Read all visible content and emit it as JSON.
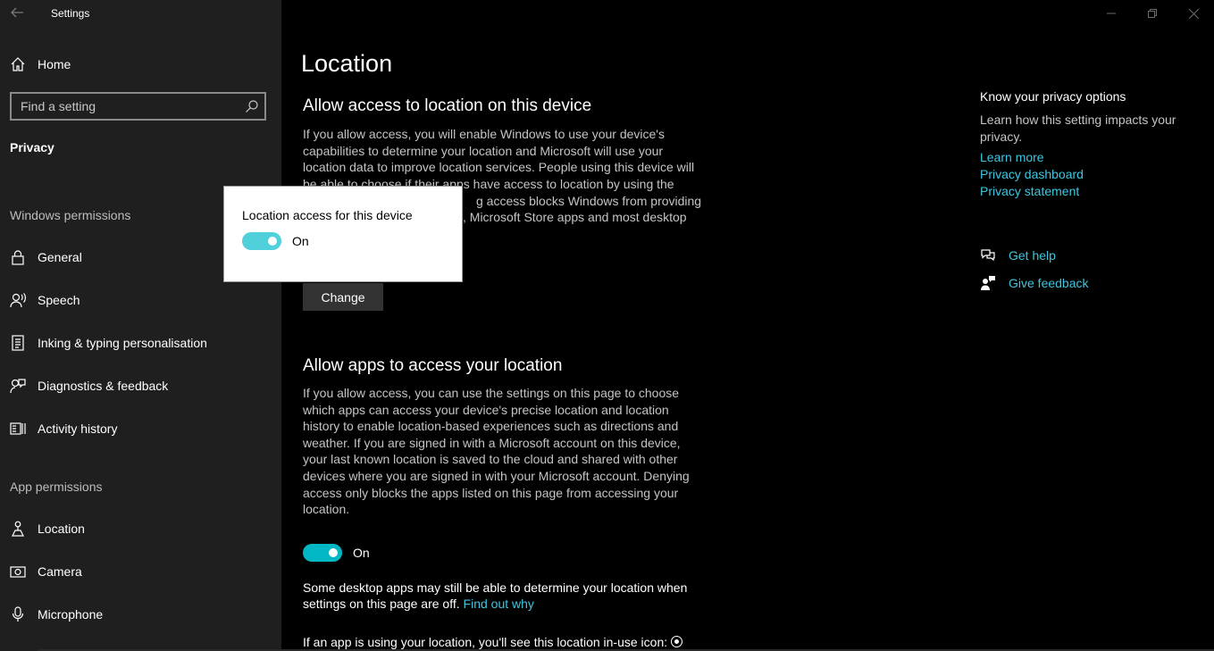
{
  "window": {
    "title": "Settings"
  },
  "sidebar": {
    "home_label": "Home",
    "search_placeholder": "Find a setting",
    "section_title": "Privacy",
    "windows_permissions_label": "Windows permissions",
    "windows_items": [
      {
        "label": "General",
        "icon": "lock-icon"
      },
      {
        "label": "Speech",
        "icon": "speech-icon"
      },
      {
        "label": "Inking & typing personalisation",
        "icon": "inking-icon"
      },
      {
        "label": "Diagnostics & feedback",
        "icon": "diagnostics-icon"
      },
      {
        "label": "Activity history",
        "icon": "activity-history-icon"
      }
    ],
    "app_permissions_label": "App permissions",
    "app_items": [
      {
        "label": "Location",
        "icon": "location-icon"
      },
      {
        "label": "Camera",
        "icon": "camera-icon"
      },
      {
        "label": "Microphone",
        "icon": "microphone-icon"
      }
    ]
  },
  "main": {
    "page_title": "Location",
    "device_section": {
      "heading": "Allow access to location on this device",
      "description_visible_top": "If you allow access, you will enable Windows to use your device's capabilities to determine your location and Microsoft will use your location data to improve location services. People using this device will",
      "description_visible_partial_1": "be able to choose if their apps have access to location by using the",
      "description_visible_partial_2": "g access blocks Windows from providing",
      "description_visible_partial_3": ", Microsoft Store apps and most desktop",
      "change_button": "Change"
    },
    "apps_section": {
      "heading": "Allow apps to access your location",
      "description": "If you allow access, you can use the settings on this page to choose which apps can access your device's precise location and location history to enable location-based experiences such as directions and weather. If you are signed in with a Microsoft account on this device, your last known location is saved to the cloud and shared with other devices where you are signed in with your Microsoft account. Denying access only blocks the apps listed on this page from accessing your location.",
      "toggle_state": "On",
      "desktop_note": "Some desktop apps may still be able to determine your location when settings on this page are off.",
      "find_out_why": "Find out why",
      "inuse_note": "If an app is using your location, you'll see this location in-use icon:"
    }
  },
  "rail": {
    "title": "Know your privacy options",
    "description": "Learn how this setting impacts your privacy.",
    "links": [
      "Learn more",
      "Privacy dashboard",
      "Privacy statement"
    ],
    "get_help": "Get help",
    "give_feedback": "Give feedback"
  },
  "popup": {
    "title": "Location access for this device",
    "toggle_state": "On"
  },
  "colors": {
    "accent": "#00b7c3",
    "link": "#3ec6e0",
    "sidebar_bg": "#1f1f1f"
  }
}
